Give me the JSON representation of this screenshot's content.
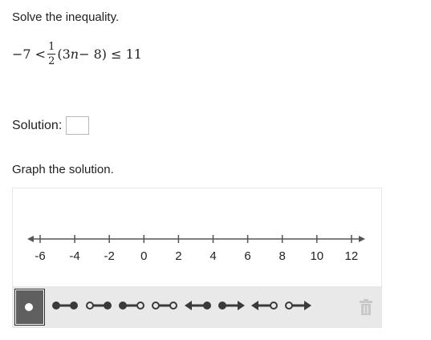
{
  "question": {
    "prompt": "Solve the inequality.",
    "math": {
      "left": "−7 <",
      "numerator": "1",
      "denominator": "2",
      "open": "(3",
      "variable": "n",
      "rest": " − 8) ≤ 11"
    }
  },
  "solution": {
    "label": "Solution:",
    "value": ""
  },
  "graph": {
    "prompt": "Graph the solution.",
    "ticks": [
      "-6",
      "-4",
      "-2",
      "0",
      "2",
      "4",
      "6",
      "8",
      "10",
      "12"
    ],
    "colors": {
      "axis": "#555555",
      "text": "#222222",
      "tool": "#3a3a3a",
      "toolbar": "#e9e9e9",
      "trash": "#c8c8c8"
    }
  },
  "toolbar": {
    "tools": [
      {
        "name": "point-tool",
        "icon": "point-icon",
        "selected": true
      },
      {
        "name": "closed-closed-segment-tool",
        "icon": "closed-closed-segment-icon"
      },
      {
        "name": "open-closed-segment-tool",
        "icon": "open-closed-segment-icon"
      },
      {
        "name": "closed-open-segment-tool",
        "icon": "closed-open-segment-icon"
      },
      {
        "name": "open-open-segment-tool",
        "icon": "open-open-segment-icon"
      },
      {
        "name": "left-ray-closed-tool",
        "icon": "left-ray-closed-icon"
      },
      {
        "name": "right-ray-closed-tool",
        "icon": "right-ray-closed-icon"
      },
      {
        "name": "left-ray-open-tool",
        "icon": "left-ray-open-icon"
      },
      {
        "name": "right-ray-open-tool",
        "icon": "right-ray-open-icon"
      },
      {
        "name": "delete-tool",
        "icon": "trash-icon"
      }
    ]
  }
}
